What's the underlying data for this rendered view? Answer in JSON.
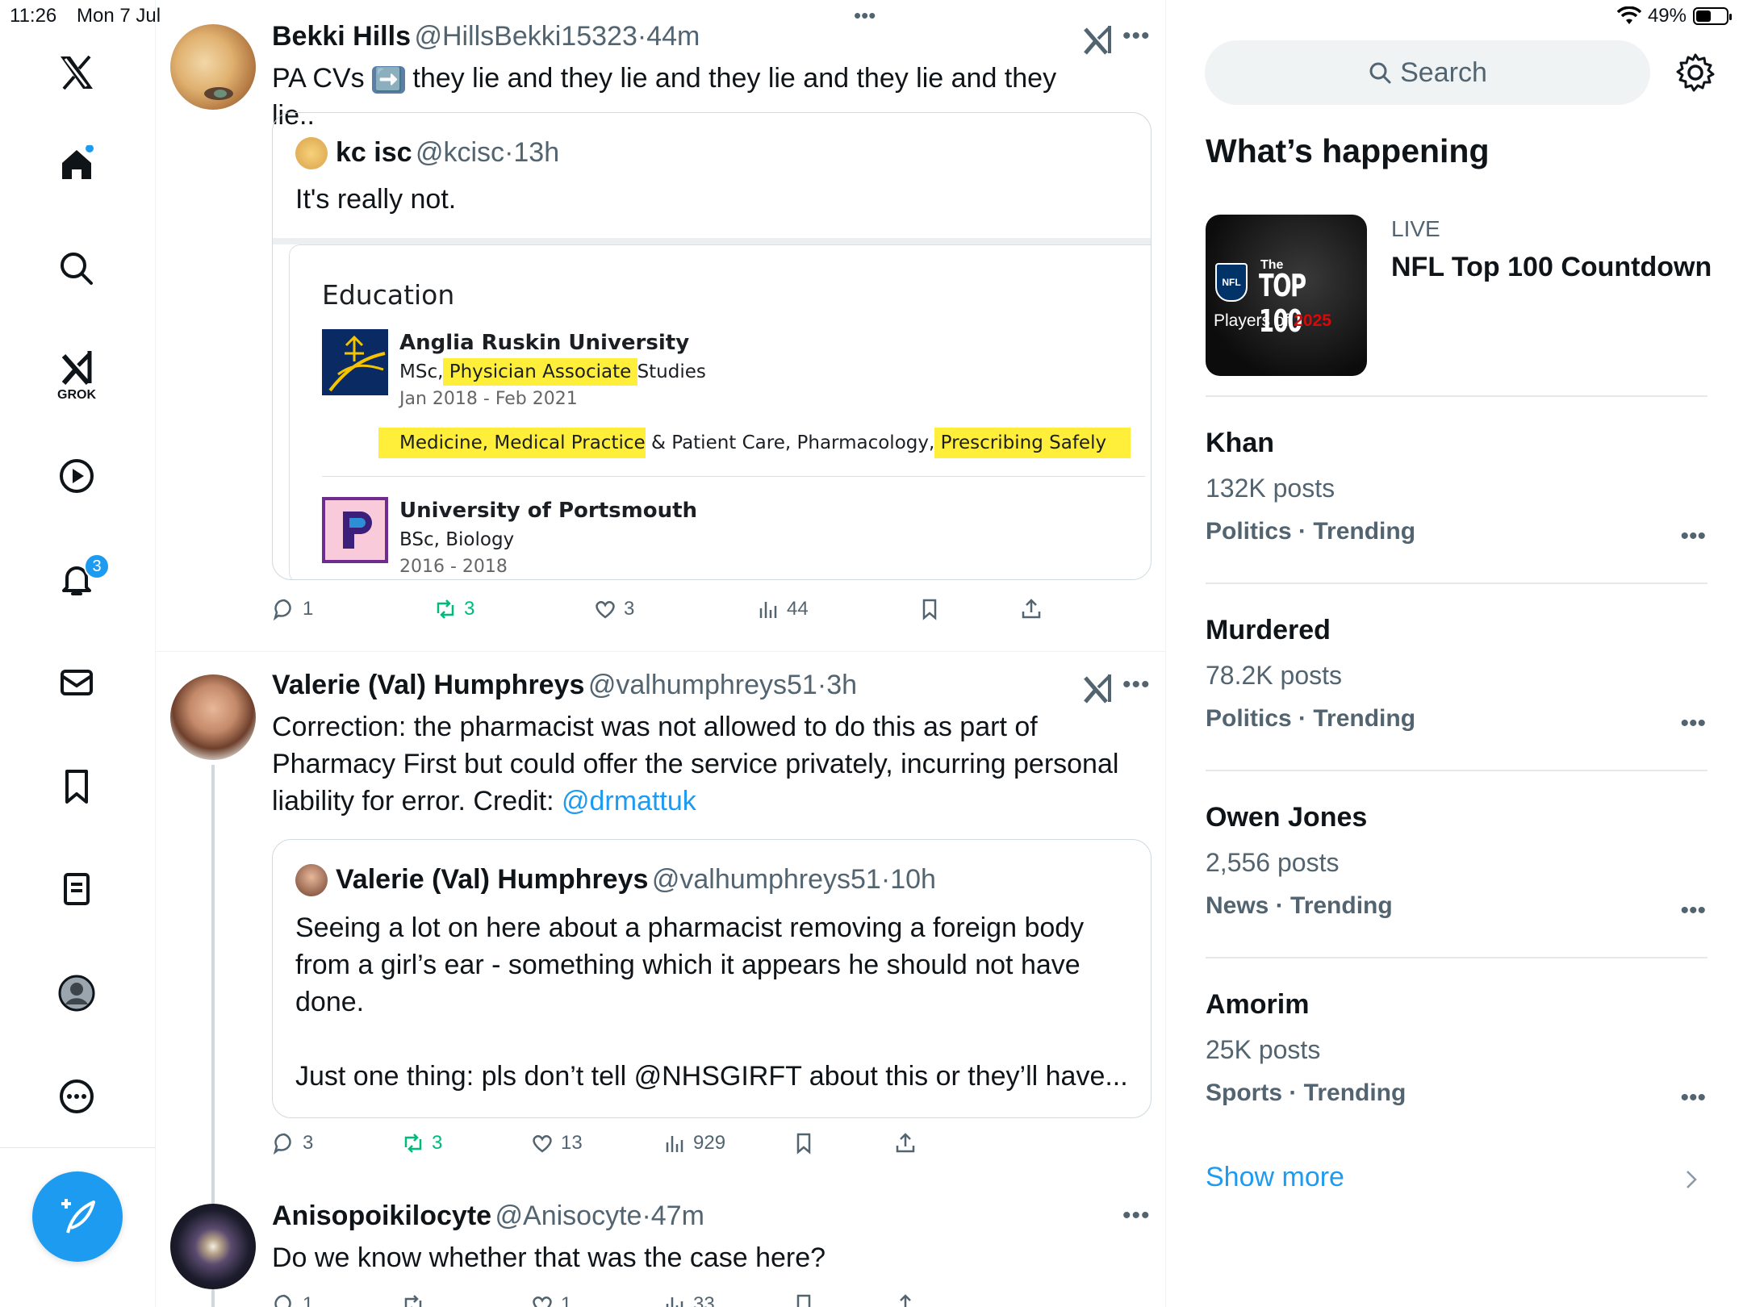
{
  "status": {
    "time": "11:26",
    "date": "Mon 7 Jul",
    "battery": "49%",
    "battery_level": 0.49
  },
  "nav": {
    "logo": "X",
    "grok_label": "GROK",
    "notifications_badge": "3",
    "icons": [
      "x-logo",
      "home-icon",
      "search-icon",
      "grok-icon",
      "video-icon",
      "bell-icon",
      "mail-icon",
      "bookmark-icon",
      "lists-icon",
      "profile-icon",
      "more-icon",
      "compose-icon"
    ]
  },
  "top_more": "•••",
  "tweets": [
    {
      "name": "Bekki Hills",
      "handle": "@HillsBekki15323",
      "time": "44m",
      "text_before": "PA CVs ",
      "arrow": "➡️",
      "text_after": " they lie and they lie and they lie and they lie and they lie..",
      "quote": {
        "name": "kc isc",
        "handle": "@kcisc",
        "time": "13h",
        "text": "It's really not.",
        "image": {
          "heading": "Education",
          "entries": [
            {
              "school": "Anglia Ruskin University",
              "degree_pre": "MSc,",
              "degree_hl": " Physician Associate ",
              "degree_post": "Studies",
              "dates": "Jan 2018 - Feb 2021",
              "skills_hl1": "Medicine, Medical Practice",
              "skills_mid": " & Patient Care, Pharmacology,",
              "skills_hl2": " Prescribing Safely"
            },
            {
              "school": "University of Portsmouth",
              "degree": "BSc, Biology",
              "dates": "2016 - 2018"
            }
          ]
        }
      },
      "actions": {
        "replies": "1",
        "reposts": "3",
        "likes": "3",
        "views": "44"
      }
    },
    {
      "name": "Valerie (Val) Humphreys",
      "handle": "@valhumphreys51",
      "time": "3h",
      "line1": "Correction: the pharmacist was not allowed to do this as part of",
      "line2": "Pharmacy First but could offer the service privately, incurring personal",
      "line3": "liability for error. Credit: ",
      "mention": "@drmattuk",
      "quote": {
        "name": "Valerie (Val) Humphreys",
        "handle": "@valhumphreys51",
        "time": "10h",
        "line1": "Seeing a lot on here about a pharmacist removing a foreign body",
        "line2": "from a girl’s ear - something which it appears he should not have",
        "line3": "done.",
        "line4": "Just one thing: pls don’t tell @NHSGIRFT about this or they’ll have..."
      },
      "actions": {
        "replies": "3",
        "reposts": "3",
        "likes": "13",
        "views": "929"
      }
    },
    {
      "name": "Anisopoikilocyte",
      "handle": "@Anisocyte",
      "time": "47m",
      "text": "Do we know whether that was the case here?",
      "actions": {
        "replies": "1",
        "reposts": "",
        "likes": "1",
        "views": "33"
      }
    }
  ],
  "sidebar": {
    "search_placeholder": "Search",
    "whats_happening": "What’s happening",
    "live": {
      "label": "LIVE",
      "title": "NFL Top 100 Countdown",
      "image_text1": "The",
      "image_text2": "TOP 100",
      "image_text3": "Players of",
      "image_year": "2025",
      "nfl": "NFL"
    },
    "trends": [
      {
        "name": "Khan",
        "count": "132K posts",
        "category": "Politics · Trending"
      },
      {
        "name": "Murdered",
        "count": "78.2K posts",
        "category": "Politics · Trending"
      },
      {
        "name": "Owen Jones",
        "count": "2,556 posts",
        "category": "News · Trending"
      },
      {
        "name": "Amorim",
        "count": "25K posts",
        "category": "Sports · Trending"
      }
    ],
    "more_glyph": "•••",
    "show_more": "Show more"
  },
  "colors": {
    "accent": "#1d9bf0",
    "repost": "#00ba7c",
    "highlight": "#ffef3a",
    "muted": "#536471"
  }
}
